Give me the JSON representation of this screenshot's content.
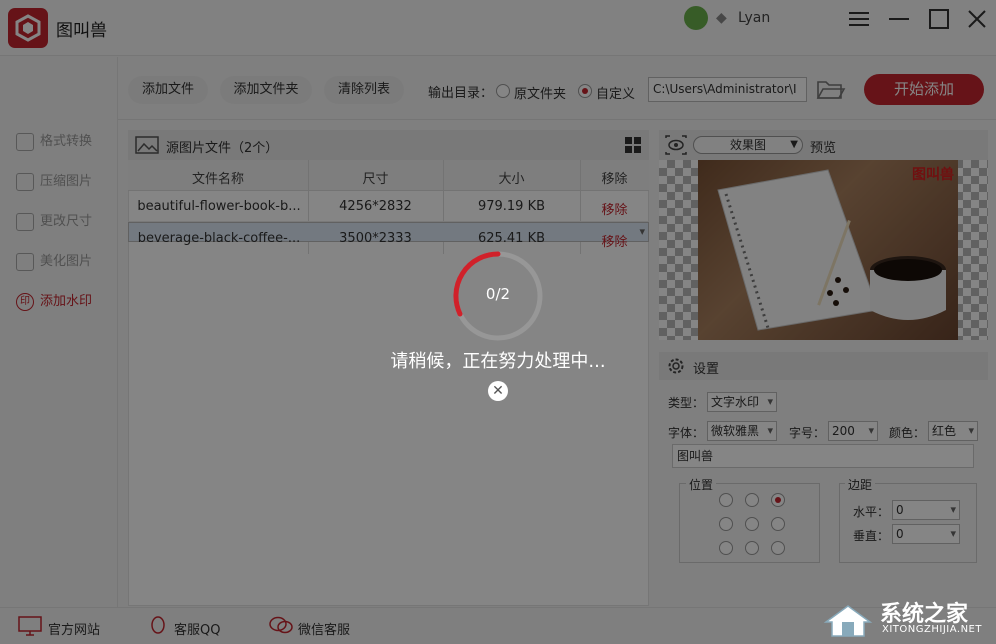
{
  "app": {
    "title": "图叫兽",
    "user": "Lyan"
  },
  "toolbar": {
    "add_file": "添加文件",
    "add_folder": "添加文件夹",
    "clear_list": "清除列表",
    "output_label": "输出目录：",
    "opt_original": "原文件夹",
    "opt_custom": "自定义",
    "output_path": "C:\\Users\\Administrator\\I",
    "start": "开始添加"
  },
  "sidebar": {
    "items": [
      {
        "label": "格式转换"
      },
      {
        "label": "压缩图片"
      },
      {
        "label": "更改尺寸"
      },
      {
        "label": "美化图片"
      },
      {
        "label": "添加水印",
        "icon": "印"
      }
    ]
  },
  "files": {
    "title": "源图片文件（2个）",
    "headers": [
      "文件名称",
      "尺寸",
      "大小",
      "移除"
    ],
    "rows": [
      {
        "name": "beautiful-flower-book-b...",
        "size": "4256*2832",
        "filesize": "979.19 KB",
        "remove": "移除"
      },
      {
        "name": "beverage-black-coffee-...",
        "size": "3500*2333",
        "filesize": "625.41 KB",
        "remove": "移除"
      }
    ]
  },
  "preview": {
    "mode": "效果图",
    "label": "预览",
    "watermark": "图叫兽"
  },
  "settings": {
    "title": "设置",
    "type_label": "类型：",
    "type_value": "文字水印",
    "font_label": "字体：",
    "font_value": "微软雅黑",
    "size_label": "字号：",
    "size_value": "200",
    "color_label": "颜色：",
    "color_value": "红色",
    "text_value": "图叫兽",
    "position_label": "位置",
    "margin_label": "边距",
    "horizontal_label": "水平：",
    "horizontal_value": "0",
    "vertical_label": "垂直：",
    "vertical_value": "0"
  },
  "footer": {
    "website": "官方网站",
    "qq": "客服QQ",
    "wechat": "微信客服"
  },
  "processing": {
    "progress": "0/2",
    "message": "请稍候，正在努力处理中..."
  },
  "watermark_site": {
    "name": "系统之家",
    "url": "XITONGZHIJIA.NET"
  },
  "colors": {
    "accent": "#c4262e",
    "overlay": "rgba(0,0,0,0.48)"
  }
}
